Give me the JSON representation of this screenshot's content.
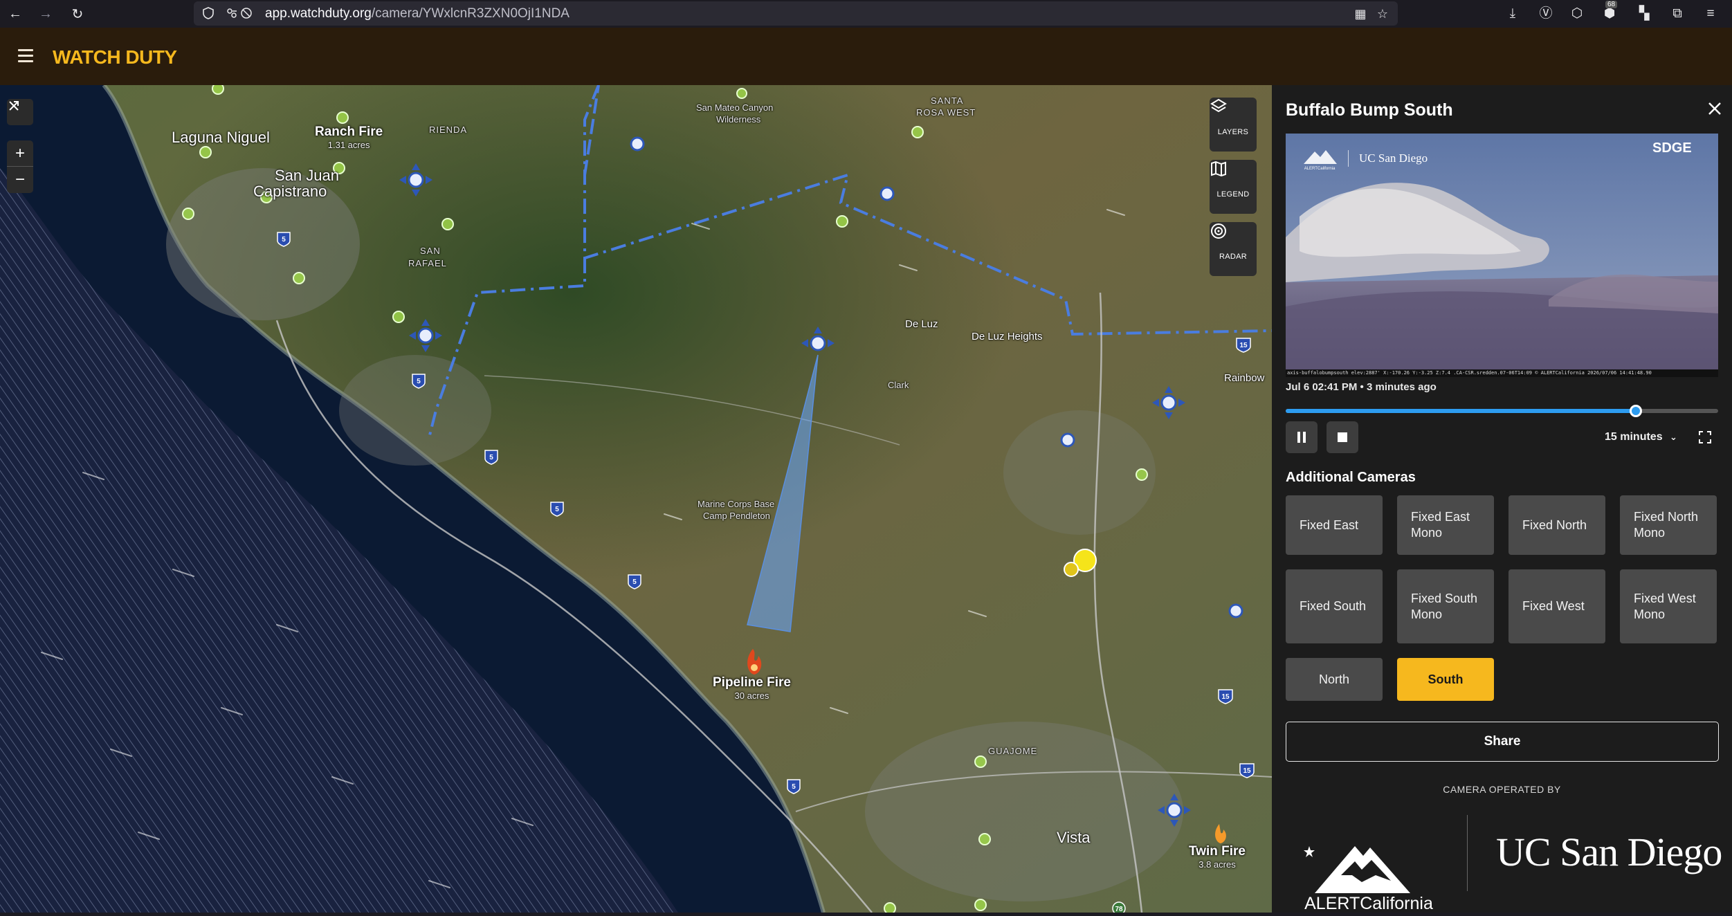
{
  "browser": {
    "url_host": "app.watchduty.org",
    "url_path": "/camera/YWxlcnR3ZXN0OjI1NDA",
    "notification_count": "68"
  },
  "app": {
    "brand": "WATCH DUTY",
    "accent_color": "#f6b81e"
  },
  "map": {
    "places": {
      "laguna_niguel": "Laguna Niguel",
      "san_juan_capistrano_1": "San Juan",
      "san_juan_capistrano_2": "Capistrano",
      "san_rafael_1": "SAN",
      "san_rafael_2": "RAFAEL",
      "rienda": "RIENDA",
      "san_mateo": "San Mateo Canyon",
      "wilderness": "Wilderness",
      "santa_rosa_1": "SANTA",
      "santa_rosa_2": "ROSA WEST",
      "de_luz": "De Luz",
      "de_luz_heights": "De Luz Heights",
      "clark": "Clark",
      "rainbow": "Rainbow",
      "camp_pendleton_1": "Marine Corps Base",
      "camp_pendleton_2": "Camp Pendleton",
      "guajome": "GUAJOME",
      "vista": "Vista"
    },
    "fires": [
      {
        "name": "Ranch Fire",
        "acres": "1.31 acres"
      },
      {
        "name": "Pipeline Fire",
        "acres": "30 acres"
      },
      {
        "name": "Twin Fire",
        "acres": "3.8 acres"
      }
    ],
    "highway_shields": [
      "5",
      "5",
      "5",
      "5",
      "5",
      "5",
      "15",
      "15",
      "15",
      "78"
    ],
    "controls": {
      "zoom_in": "+",
      "zoom_out": "−",
      "layers": "LAYERS",
      "legend": "LEGEND",
      "radar": "RADAR"
    }
  },
  "panel": {
    "title": "Buffalo Bump South",
    "image_brand_left": "UC San Diego",
    "image_brand_right": "SDGE",
    "image_footer": "axis-buffalobumpsouth elev:2887' X:-170.26 Y:-3.25 Z:7.4 .CA-CSR.sredden.07-06T14:09 © ALERTCalifornia 2026/07/06 14:41:48.90",
    "timestamp": "Jul 6 02:41 PM • 3 minutes ago",
    "playback_position": 0.81,
    "duration": "15 minutes",
    "additional_cameras_heading": "Additional Cameras",
    "cameras": [
      {
        "label": "Fixed East",
        "active": false
      },
      {
        "label": "Fixed East Mono",
        "active": false
      },
      {
        "label": "Fixed North",
        "active": false
      },
      {
        "label": "Fixed North Mono",
        "active": false
      },
      {
        "label": "Fixed South",
        "active": false
      },
      {
        "label": "Fixed South Mono",
        "active": false
      },
      {
        "label": "Fixed West",
        "active": false
      },
      {
        "label": "Fixed West Mono",
        "active": false
      },
      {
        "label": "North",
        "active": false
      },
      {
        "label": "South",
        "active": true
      }
    ],
    "share": "Share",
    "operated_by": "CAMERA OPERATED BY",
    "operator_logo_1": "ALERTCalifornia",
    "operator_logo_2": "UC San Diego"
  }
}
